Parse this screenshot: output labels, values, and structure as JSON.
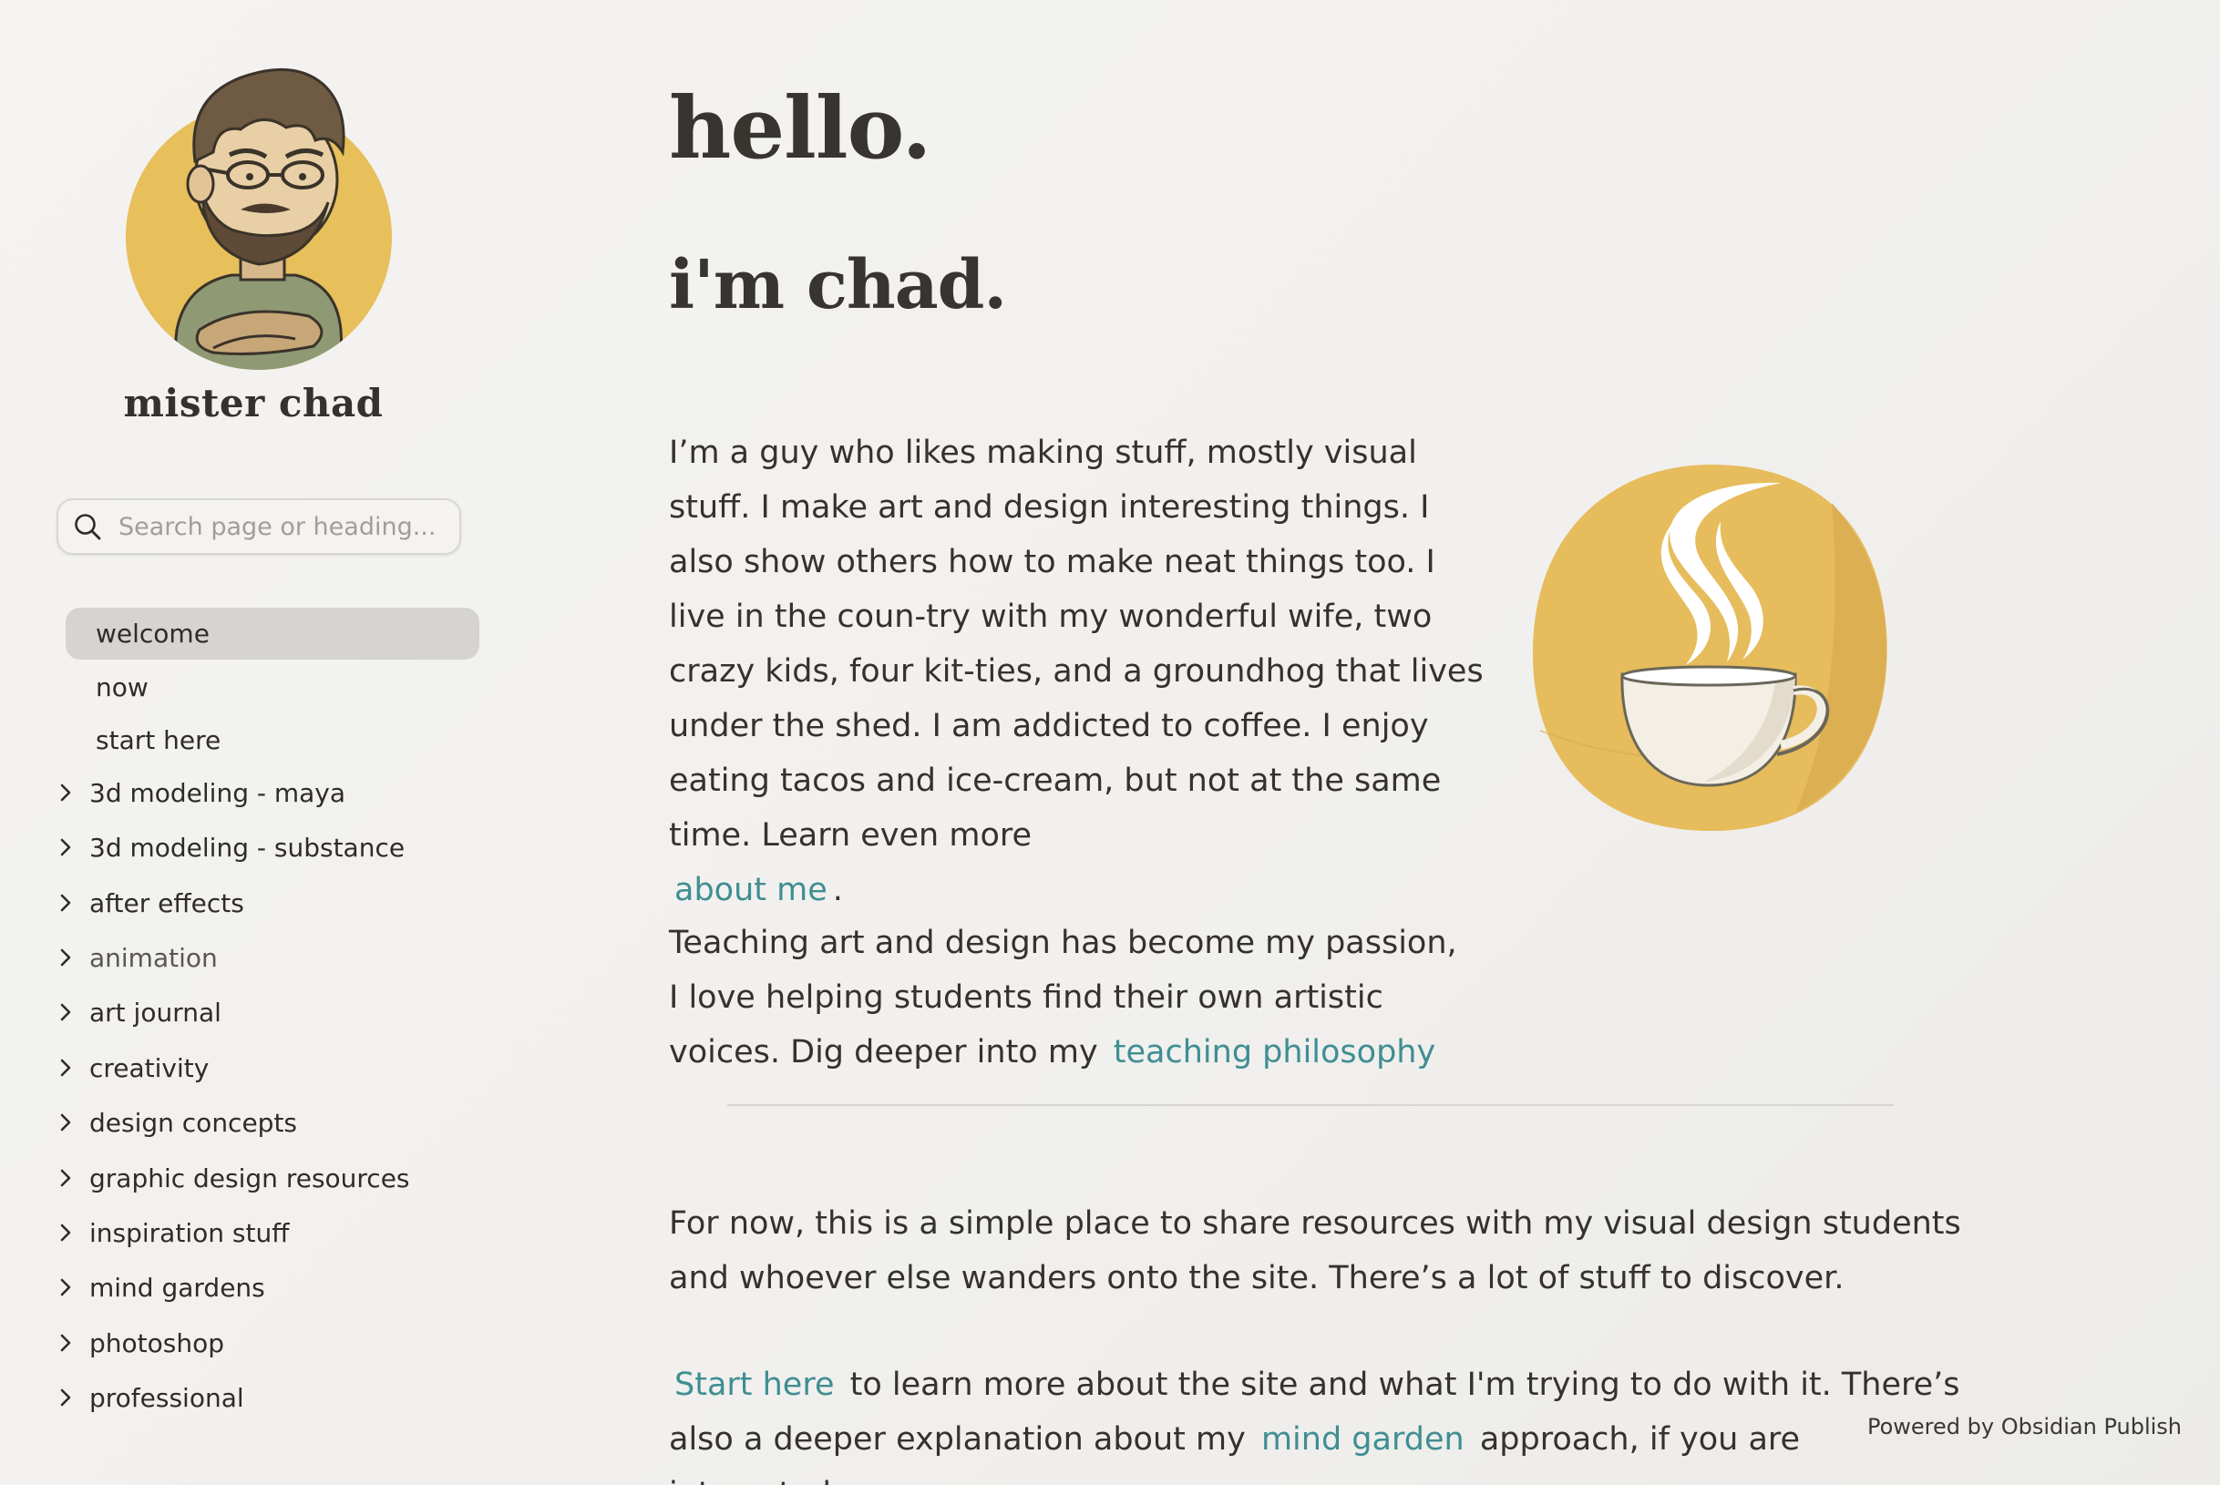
{
  "sidebar": {
    "site_name": "mister chad",
    "avatar_icon": "cartoon-avatar-icon",
    "search": {
      "placeholder": "Search page or heading...",
      "value": ""
    },
    "items": [
      {
        "label": "welcome",
        "type": "page",
        "active": true
      },
      {
        "label": "now",
        "type": "page"
      },
      {
        "label": "start here",
        "type": "page"
      },
      {
        "label": "3d modeling - maya",
        "type": "folder"
      },
      {
        "label": "3d modeling - substance",
        "type": "folder"
      },
      {
        "label": "after effects",
        "type": "folder"
      },
      {
        "label": "animation",
        "type": "folder"
      },
      {
        "label": "art journal",
        "type": "folder"
      },
      {
        "label": "creativity",
        "type": "folder"
      },
      {
        "label": "design concepts",
        "type": "folder"
      },
      {
        "label": "graphic design resources",
        "type": "folder"
      },
      {
        "label": "inspiration stuff",
        "type": "folder"
      },
      {
        "label": "mind gardens",
        "type": "folder"
      },
      {
        "label": "photoshop",
        "type": "folder"
      },
      {
        "label": "professional",
        "type": "folder"
      }
    ]
  },
  "main": {
    "heading1": "hello.",
    "heading2": "i'm chad.",
    "intro_text": "I’m a guy who likes making stuff, mostly visual stuff. I make art and design interesting things. I also show others how to make neat things too. I live in the coun-try with my wonderful wife, two crazy kids, four kit-ties, and a groundhog that lives under the shed. I am addicted to coffee. I enjoy eating tacos and ice-cream, but not at the same time. Learn even more",
    "intro_link": "about me",
    "intro_end": ".",
    "teaching_text": "Teaching art and design has become my passion, I love helping students find their own artistic voices. Dig deeper into my",
    "teaching_link": "teaching philosophy",
    "for_now_text": "For now, this is a simple place to share resources with my visual design students and whoever else wanders onto the site. There’s a lot of stuff to discover.",
    "start_link": "Start here",
    "start_text": "to learn more about the site and what I'm trying to do with it. There’s also a deeper explanation about my",
    "mind_garden_link": "mind garden",
    "start_end": "approach, if you are interested.",
    "coffee_icon": "coffee-cup-icon"
  },
  "footer": {
    "powered_by": "Powered by Obsidian Publish"
  },
  "colors": {
    "background": "#f1f0ee",
    "link": "#3f8e92",
    "active_nav": "#d6d4d0",
    "heading": "#38342f",
    "coffee_yellow": "#e6bc5c"
  }
}
